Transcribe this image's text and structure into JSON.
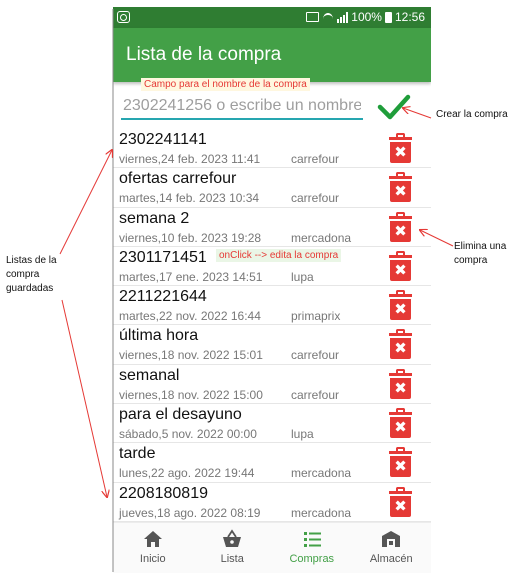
{
  "status_bar": {
    "battery": "100%",
    "time": "12:56"
  },
  "app_bar": {
    "title": "Lista de la compra"
  },
  "name_input": {
    "placeholder": "2302241256 o escribe un nombre"
  },
  "lists": [
    {
      "name": "2302241141",
      "date": "viernes,24 feb. 2023 11:41",
      "store": "carrefour"
    },
    {
      "name": "ofertas carrefour",
      "date": "martes,14 feb. 2023 10:34",
      "store": "carrefour"
    },
    {
      "name": "semana 2",
      "date": "viernes,10 feb. 2023 19:28",
      "store": "mercadona"
    },
    {
      "name": "2301171451",
      "date": "martes,17 ene. 2023 14:51",
      "store": "lupa"
    },
    {
      "name": "2211221644",
      "date": "martes,22 nov. 2022 16:44",
      "store": "primaprix"
    },
    {
      "name": "última hora",
      "date": "viernes,18 nov. 2022 15:01",
      "store": "carrefour"
    },
    {
      "name": "semanal",
      "date": "viernes,18 nov. 2022 15:00",
      "store": "carrefour"
    },
    {
      "name": "para el desayuno",
      "date": "sábado,5 nov. 2022 00:00",
      "store": "lupa"
    },
    {
      "name": "tarde",
      "date": "lunes,22 ago. 2022 19:44",
      "store": "mercadona"
    },
    {
      "name": "2208180819",
      "date": "jueves,18 ago. 2022 08:19",
      "store": "mercadona"
    }
  ],
  "trash_glyph": "✖",
  "bottom_nav": [
    {
      "label": "Inicio",
      "icon": "home-icon",
      "active": false
    },
    {
      "label": "Lista",
      "icon": "basket-icon",
      "active": false
    },
    {
      "label": "Compras",
      "icon": "list-icon",
      "active": true
    },
    {
      "label": "Almacén",
      "icon": "store-icon",
      "active": false
    }
  ],
  "annotations": {
    "name_field": "Campo para el nombre de la compra",
    "create": "Crear la compra",
    "saved_lists": "Listas de la\ncompra\nguardadas",
    "delete": "Elimina una\ncompra",
    "onclick": "onClick --> edita la compra"
  },
  "colors": {
    "primary": "#43a047",
    "status_bar": "#2f7d32",
    "accent": "#26a6b0",
    "danger": "#e53935"
  }
}
